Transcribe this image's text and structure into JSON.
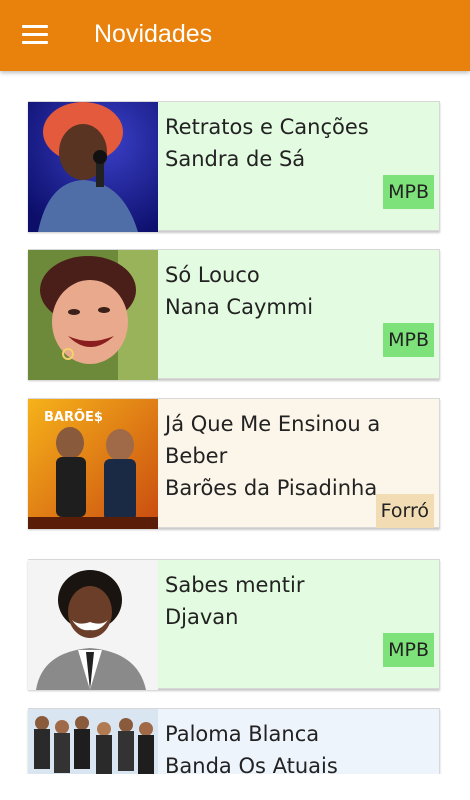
{
  "header": {
    "title": "Novidades",
    "menu_icon": "hamburger-menu-icon"
  },
  "albums": [
    {
      "album": "Retratos e Canções",
      "artist": "Sandra de Sá",
      "genre": "MPB"
    },
    {
      "album": "Só Louco",
      "artist": "Nana Caymmi",
      "genre": "MPB"
    },
    {
      "album": "Já Que Me Ensinou a Beber",
      "artist": "Barões da Pisadinha",
      "genre": "Forró",
      "cover_text": "BARÕE$"
    },
    {
      "album": "Sabes mentir",
      "artist": "Djavan",
      "genre": "MPB"
    },
    {
      "album": "Paloma Blanca",
      "artist": "Banda Os Atuais",
      "genre": ""
    }
  ],
  "colors": {
    "appbar": "#e8820c",
    "mpb_badge": "#7ee27b",
    "forro_badge": "#f2dcb4",
    "card_mpb": "#e3fbe0",
    "card_forro": "#fcf6ea",
    "card_other": "#eef4fc"
  }
}
